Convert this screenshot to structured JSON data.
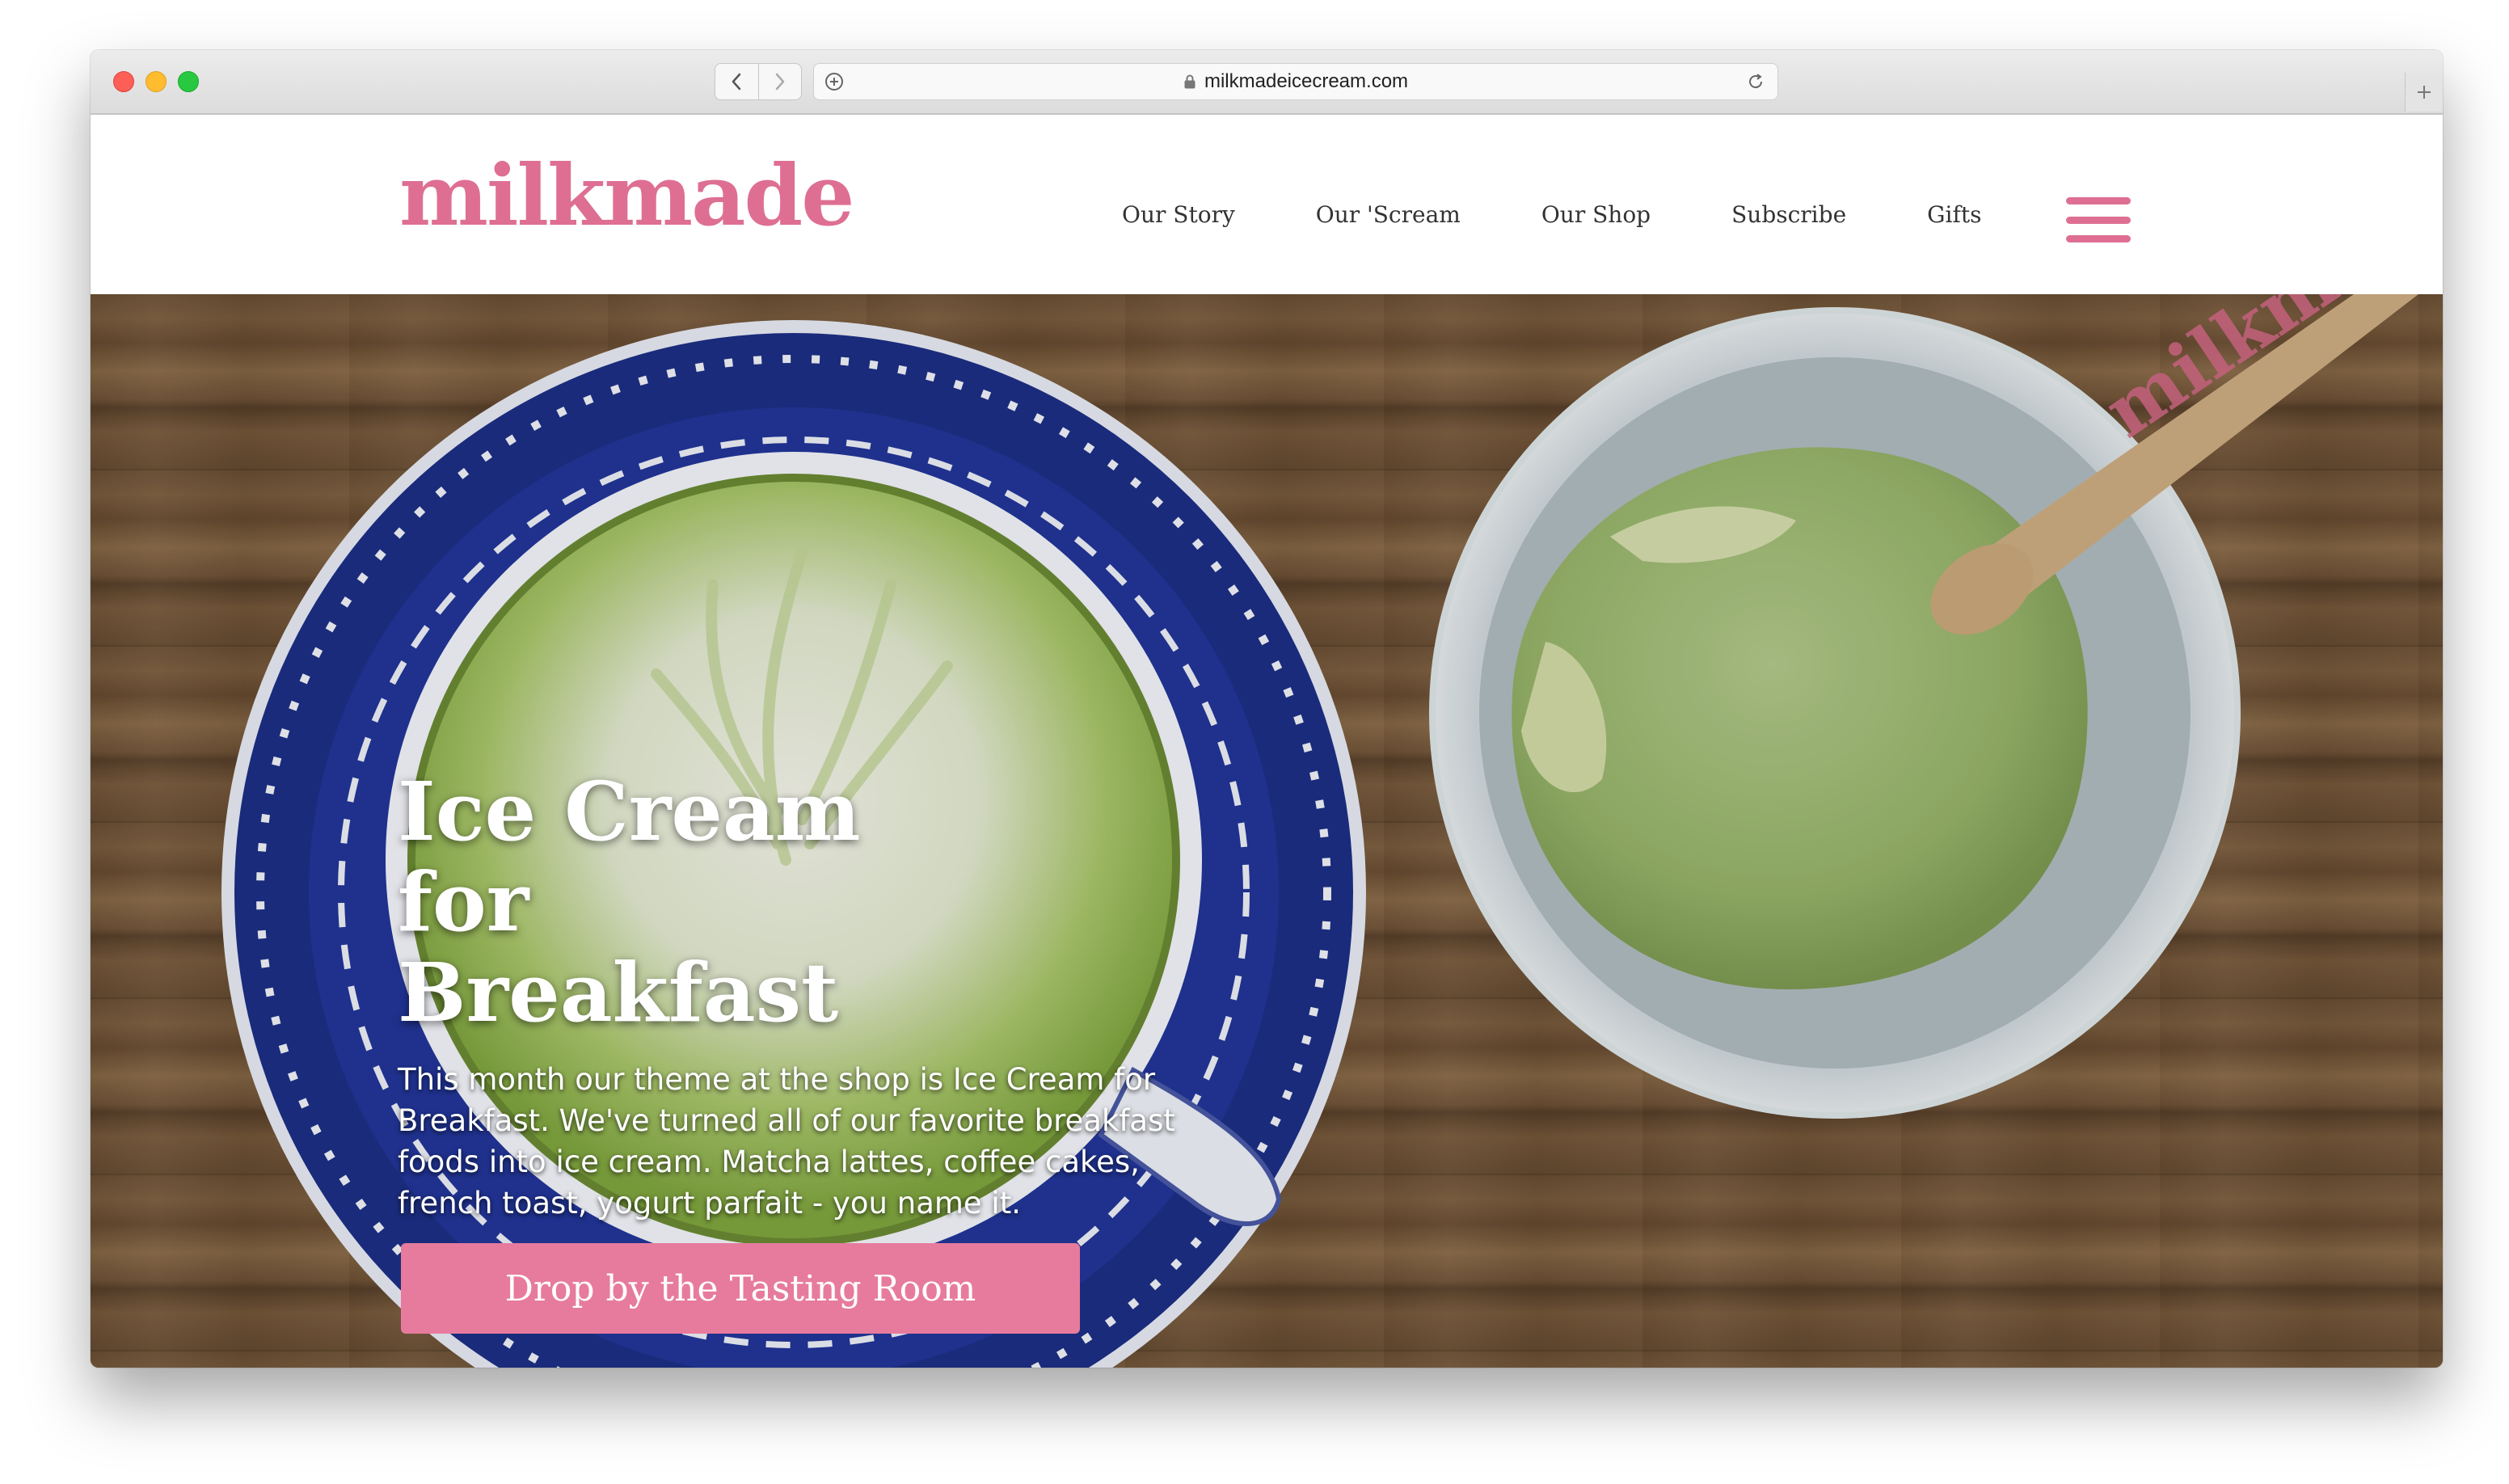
{
  "browser": {
    "url": "milkmadeicecream.com",
    "icons": {
      "back": "chevron-left-icon",
      "forward": "chevron-right-icon",
      "share": "plus-circle-icon",
      "lock": "lock-icon",
      "reload": "reload-icon",
      "new_tab": "plus-icon"
    }
  },
  "site": {
    "logo": "milkmade",
    "nav": [
      {
        "label": "Our Story"
      },
      {
        "label": "Our 'Scream"
      },
      {
        "label": "Our Shop"
      },
      {
        "label": "Subscribe"
      },
      {
        "label": "Gifts"
      }
    ],
    "menu_icon": "hamburger-menu-icon"
  },
  "hero": {
    "title": "Ice Cream for Breakfast",
    "text": "This month our theme at the shop is Ice Cream for Breakfast. We've turned all of our favorite breakfast foods into ice cream. Matcha lattes, coffee cakes, french toast, yogurt parfait - you name it.",
    "cta": "Drop by the Tasting Room",
    "spoon_text": "milkmade"
  },
  "colors": {
    "brand_pink": "#de6f93",
    "cta_pink": "#e77b9d",
    "matcha_green": "#9bb865"
  }
}
